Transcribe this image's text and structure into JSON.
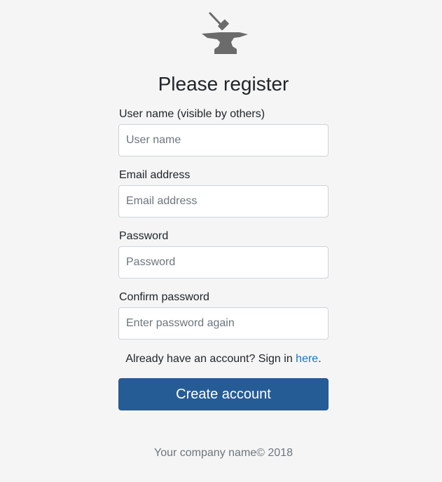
{
  "brand": {
    "logo_icon": "anvil-hammer-icon",
    "logo_color": "#6b6b6b"
  },
  "form": {
    "title": "Please register",
    "fields": [
      {
        "label": "User name (visible by others)",
        "placeholder": "User name",
        "value": ""
      },
      {
        "label": "Email address",
        "placeholder": "Email address",
        "value": ""
      },
      {
        "label": "Password",
        "placeholder": "Password",
        "value": ""
      },
      {
        "label": "Confirm password",
        "placeholder": "Enter password again",
        "value": ""
      }
    ],
    "signin_text": "Already have an account? Sign in ",
    "signin_link": "here",
    "signin_suffix": ".",
    "submit_label": "Create account"
  },
  "footer": {
    "text": "Your company name© 2018"
  },
  "colors": {
    "background": "#f5f5f5",
    "primary_button": "#265c96",
    "link": "#1a73c9",
    "muted_text": "#6c757d"
  }
}
